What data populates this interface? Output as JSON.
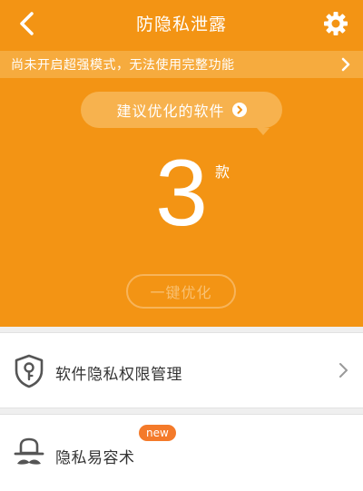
{
  "header": {
    "title": "防隐私泄露"
  },
  "warning_bar": {
    "text": "尚未开启超强模式，无法使用完整功能"
  },
  "summary": {
    "suggest_label": "建议优化的软件",
    "count": "3",
    "count_unit": "款",
    "optimize_button": "一键优化"
  },
  "features": [
    {
      "label": "软件隐私权限管理",
      "icon": "shield-key-icon"
    },
    {
      "label": "隐私易容术",
      "icon": "hat-mustache-icon",
      "badge": "new"
    }
  ],
  "colors": {
    "primary": "#f39414",
    "warning_bar": "#f6ab3e",
    "badge": "#f47a2a"
  }
}
